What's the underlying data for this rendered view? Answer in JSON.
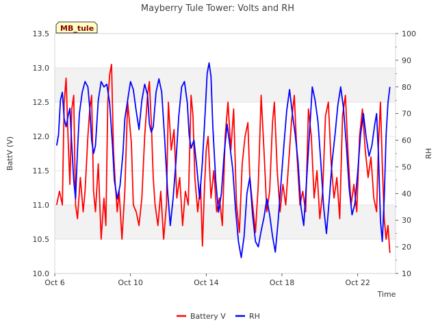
{
  "chart_data": {
    "type": "line",
    "title": "Mayberry Tule Tower: Volts and RH",
    "station_label": "MB_tule",
    "xlabel": "Time",
    "ylabel_left": "BattV (V)",
    "ylabel_right": "RH",
    "x_range_days": [
      0,
      18
    ],
    "x_ticks": [
      {
        "day": 0,
        "label": "Oct 6"
      },
      {
        "day": 4,
        "label": "Oct 10"
      },
      {
        "day": 8,
        "label": "Oct 14"
      },
      {
        "day": 12,
        "label": "Oct 18"
      },
      {
        "day": 16,
        "label": "Oct 22"
      }
    ],
    "ylim_left": [
      10.0,
      13.5
    ],
    "yticks_left": [
      "10.0",
      "10.5",
      "11.0",
      "11.5",
      "12.0",
      "12.5",
      "13.0",
      "13.5"
    ],
    "ylim_right": [
      10,
      100
    ],
    "yticks_right": [
      "10",
      "20",
      "30",
      "40",
      "50",
      "60",
      "70",
      "80",
      "90",
      "100"
    ],
    "shaded_bands_left": [
      [
        10.5,
        11.0
      ],
      [
        12.5,
        13.0
      ]
    ],
    "grid": true,
    "legend_position": "bottom-center",
    "series": [
      {
        "name": "Battery V",
        "axis": "left",
        "color": "#ff0000",
        "points": [
          [
            0.1,
            11.0
          ],
          [
            0.25,
            11.2
          ],
          [
            0.4,
            11.0
          ],
          [
            0.5,
            12.5
          ],
          [
            0.6,
            12.85
          ],
          [
            0.7,
            12.0
          ],
          [
            0.8,
            11.3
          ],
          [
            0.9,
            12.4
          ],
          [
            1.0,
            12.6
          ],
          [
            1.1,
            11.0
          ],
          [
            1.2,
            10.8
          ],
          [
            1.35,
            11.4
          ],
          [
            1.5,
            10.9
          ],
          [
            1.6,
            11.2
          ],
          [
            1.75,
            12.0
          ],
          [
            1.85,
            12.4
          ],
          [
            1.95,
            12.6
          ],
          [
            2.05,
            11.2
          ],
          [
            2.15,
            10.9
          ],
          [
            2.3,
            11.6
          ],
          [
            2.45,
            10.5
          ],
          [
            2.6,
            11.1
          ],
          [
            2.7,
            10.7
          ],
          [
            2.8,
            12.5
          ],
          [
            2.9,
            12.9
          ],
          [
            3.0,
            13.05
          ],
          [
            3.1,
            11.8
          ],
          [
            3.2,
            11.3
          ],
          [
            3.3,
            10.9
          ],
          [
            3.4,
            11.2
          ],
          [
            3.55,
            10.5
          ],
          [
            3.7,
            11.2
          ],
          [
            3.85,
            12.5
          ],
          [
            3.95,
            12.2
          ],
          [
            4.05,
            11.9
          ],
          [
            4.15,
            11.0
          ],
          [
            4.3,
            10.9
          ],
          [
            4.45,
            10.7
          ],
          [
            4.6,
            11.1
          ],
          [
            4.75,
            12.0
          ],
          [
            4.9,
            12.6
          ],
          [
            5.0,
            12.8
          ],
          [
            5.1,
            12.2
          ],
          [
            5.2,
            11.4
          ],
          [
            5.3,
            11.0
          ],
          [
            5.45,
            10.7
          ],
          [
            5.6,
            11.2
          ],
          [
            5.75,
            10.5
          ],
          [
            5.9,
            11.0
          ],
          [
            6.0,
            12.5
          ],
          [
            6.15,
            11.8
          ],
          [
            6.3,
            12.1
          ],
          [
            6.45,
            11.1
          ],
          [
            6.6,
            11.4
          ],
          [
            6.75,
            10.7
          ],
          [
            6.9,
            11.2
          ],
          [
            7.05,
            11.0
          ],
          [
            7.2,
            12.6
          ],
          [
            7.3,
            12.3
          ],
          [
            7.4,
            11.4
          ],
          [
            7.55,
            10.9
          ],
          [
            7.7,
            11.3
          ],
          [
            7.8,
            10.4
          ],
          [
            7.9,
            11.2
          ],
          [
            8.0,
            11.8
          ],
          [
            8.1,
            12.0
          ],
          [
            8.25,
            11.1
          ],
          [
            8.4,
            11.5
          ],
          [
            8.55,
            10.9
          ],
          [
            8.7,
            11.1
          ],
          [
            8.85,
            10.7
          ],
          [
            9.0,
            12.0
          ],
          [
            9.15,
            12.5
          ],
          [
            9.3,
            11.8
          ],
          [
            9.45,
            12.4
          ],
          [
            9.6,
            11.0
          ],
          [
            9.75,
            10.6
          ],
          [
            9.9,
            11.6
          ],
          [
            10.05,
            12.0
          ],
          [
            10.2,
            12.2
          ],
          [
            10.3,
            11.4
          ],
          [
            10.45,
            11.0
          ],
          [
            10.6,
            10.6
          ],
          [
            10.75,
            11.3
          ],
          [
            10.9,
            12.6
          ],
          [
            11.05,
            11.8
          ],
          [
            11.2,
            10.9
          ],
          [
            11.35,
            11.2
          ],
          [
            11.5,
            12.2
          ],
          [
            11.6,
            12.5
          ],
          [
            11.75,
            11.5
          ],
          [
            11.9,
            10.9
          ],
          [
            12.05,
            11.3
          ],
          [
            12.2,
            11.0
          ],
          [
            12.35,
            11.6
          ],
          [
            12.5,
            12.2
          ],
          [
            12.65,
            12.6
          ],
          [
            12.8,
            11.7
          ],
          [
            12.95,
            11.0
          ],
          [
            13.1,
            11.2
          ],
          [
            13.25,
            10.9
          ],
          [
            13.4,
            12.4
          ],
          [
            13.55,
            12.0
          ],
          [
            13.7,
            11.1
          ],
          [
            13.85,
            11.5
          ],
          [
            14.0,
            10.8
          ],
          [
            14.15,
            11.2
          ],
          [
            14.3,
            12.3
          ],
          [
            14.45,
            12.5
          ],
          [
            14.6,
            11.6
          ],
          [
            14.75,
            11.1
          ],
          [
            14.9,
            11.4
          ],
          [
            15.05,
            10.8
          ],
          [
            15.2,
            12.3
          ],
          [
            15.35,
            12.6
          ],
          [
            15.5,
            11.7
          ],
          [
            15.65,
            11.0
          ],
          [
            15.8,
            11.3
          ],
          [
            15.95,
            10.9
          ],
          [
            16.1,
            12.0
          ],
          [
            16.25,
            12.4
          ],
          [
            16.4,
            11.8
          ],
          [
            16.55,
            11.4
          ],
          [
            16.7,
            11.7
          ],
          [
            16.85,
            11.1
          ],
          [
            17.0,
            10.9
          ],
          [
            17.1,
            11.9
          ],
          [
            17.2,
            12.5
          ],
          [
            17.3,
            11.6
          ],
          [
            17.4,
            10.8
          ],
          [
            17.5,
            10.5
          ],
          [
            17.6,
            10.7
          ],
          [
            17.7,
            10.3
          ]
        ]
      },
      {
        "name": "RH",
        "axis": "right",
        "color": "#0000ff",
        "points": [
          [
            0.1,
            58
          ],
          [
            0.2,
            62
          ],
          [
            0.3,
            75
          ],
          [
            0.4,
            78
          ],
          [
            0.5,
            68
          ],
          [
            0.6,
            65
          ],
          [
            0.7,
            69
          ],
          [
            0.8,
            72
          ],
          [
            0.9,
            58
          ],
          [
            1.0,
            45
          ],
          [
            1.1,
            38
          ],
          [
            1.2,
            56
          ],
          [
            1.3,
            70
          ],
          [
            1.45,
            78
          ],
          [
            1.6,
            82
          ],
          [
            1.75,
            80
          ],
          [
            1.85,
            72
          ],
          [
            1.95,
            60
          ],
          [
            2.05,
            55
          ],
          [
            2.15,
            58
          ],
          [
            2.3,
            75
          ],
          [
            2.45,
            82
          ],
          [
            2.6,
            80
          ],
          [
            2.75,
            81
          ],
          [
            2.9,
            74
          ],
          [
            3.05,
            58
          ],
          [
            3.15,
            45
          ],
          [
            3.3,
            38
          ],
          [
            3.45,
            43
          ],
          [
            3.6,
            55
          ],
          [
            3.7,
            68
          ],
          [
            3.85,
            75
          ],
          [
            4.0,
            82
          ],
          [
            4.15,
            79
          ],
          [
            4.3,
            71
          ],
          [
            4.45,
            64
          ],
          [
            4.6,
            75
          ],
          [
            4.75,
            81
          ],
          [
            4.9,
            77
          ],
          [
            5.0,
            66
          ],
          [
            5.1,
            63
          ],
          [
            5.2,
            65
          ],
          [
            5.35,
            78
          ],
          [
            5.5,
            83
          ],
          [
            5.65,
            78
          ],
          [
            5.8,
            61
          ],
          [
            5.95,
            42
          ],
          [
            6.1,
            28
          ],
          [
            6.25,
            38
          ],
          [
            6.4,
            52
          ],
          [
            6.55,
            69
          ],
          [
            6.7,
            80
          ],
          [
            6.85,
            82
          ],
          [
            7.0,
            74
          ],
          [
            7.1,
            62
          ],
          [
            7.2,
            57
          ],
          [
            7.35,
            60
          ],
          [
            7.5,
            50
          ],
          [
            7.65,
            38
          ],
          [
            7.8,
            52
          ],
          [
            7.95,
            71
          ],
          [
            8.05,
            85
          ],
          [
            8.15,
            89
          ],
          [
            8.25,
            84
          ],
          [
            8.35,
            65
          ],
          [
            8.5,
            45
          ],
          [
            8.65,
            33
          ],
          [
            8.8,
            40
          ],
          [
            8.95,
            55
          ],
          [
            9.1,
            66
          ],
          [
            9.25,
            58
          ],
          [
            9.4,
            49
          ],
          [
            9.55,
            34
          ],
          [
            9.7,
            22
          ],
          [
            9.85,
            16
          ],
          [
            10.0,
            24
          ],
          [
            10.15,
            40
          ],
          [
            10.3,
            46
          ],
          [
            10.45,
            32
          ],
          [
            10.6,
            22
          ],
          [
            10.75,
            20
          ],
          [
            10.9,
            26
          ],
          [
            11.05,
            31
          ],
          [
            11.2,
            38
          ],
          [
            11.35,
            32
          ],
          [
            11.5,
            24
          ],
          [
            11.65,
            18
          ],
          [
            11.8,
            30
          ],
          [
            11.95,
            44
          ],
          [
            12.1,
            58
          ],
          [
            12.25,
            71
          ],
          [
            12.4,
            79
          ],
          [
            12.55,
            70
          ],
          [
            12.7,
            62
          ],
          [
            12.85,
            52
          ],
          [
            13.0,
            35
          ],
          [
            13.15,
            28
          ],
          [
            13.3,
            45
          ],
          [
            13.45,
            62
          ],
          [
            13.6,
            80
          ],
          [
            13.75,
            75
          ],
          [
            13.9,
            67
          ],
          [
            14.05,
            52
          ],
          [
            14.2,
            35
          ],
          [
            14.35,
            25
          ],
          [
            14.5,
            38
          ],
          [
            14.65,
            52
          ],
          [
            14.8,
            62
          ],
          [
            14.95,
            73
          ],
          [
            15.1,
            80
          ],
          [
            15.25,
            72
          ],
          [
            15.4,
            58
          ],
          [
            15.55,
            42
          ],
          [
            15.7,
            32
          ],
          [
            15.85,
            36
          ],
          [
            16.0,
            48
          ],
          [
            16.15,
            62
          ],
          [
            16.3,
            70
          ],
          [
            16.45,
            61
          ],
          [
            16.6,
            54
          ],
          [
            16.75,
            58
          ],
          [
            16.9,
            66
          ],
          [
            17.0,
            70
          ],
          [
            17.1,
            54
          ],
          [
            17.2,
            30
          ],
          [
            17.3,
            22
          ],
          [
            17.4,
            38
          ],
          [
            17.5,
            62
          ],
          [
            17.6,
            74
          ],
          [
            17.7,
            80
          ]
        ]
      }
    ]
  }
}
